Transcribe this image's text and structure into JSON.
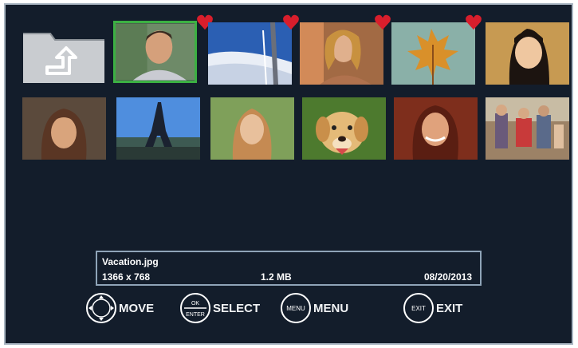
{
  "file_info": {
    "name": "Vacation.jpg",
    "resolution": "1366 x 768",
    "size": "1.2 MB",
    "date": "08/20/2013"
  },
  "controls": {
    "move_label": "MOVE",
    "select_label": "SELECT",
    "select_icon_top": "OK",
    "select_icon_bottom": "ENTER",
    "menu_label": "MENU",
    "menu_icon_text": "MENU",
    "exit_label": "EXIT",
    "exit_icon_text": "EXIT"
  },
  "thumbnails": [
    {
      "name": "up-folder",
      "favorite": false,
      "selected": false
    },
    {
      "name": "man-portrait",
      "favorite": true,
      "selected": true
    },
    {
      "name": "snow-scene",
      "favorite": true,
      "selected": false
    },
    {
      "name": "laughing-woman",
      "favorite": true,
      "selected": false
    },
    {
      "name": "autumn-leaf",
      "favorite": true,
      "selected": false
    },
    {
      "name": "girl-portrait",
      "favorite": false,
      "selected": false
    },
    {
      "name": "woman-smiling",
      "favorite": false,
      "selected": false
    },
    {
      "name": "eiffel-tower",
      "favorite": false,
      "selected": false
    },
    {
      "name": "woman-outdoor",
      "favorite": false,
      "selected": false
    },
    {
      "name": "dog",
      "favorite": false,
      "selected": false
    },
    {
      "name": "woman-red-hair",
      "favorite": false,
      "selected": false
    },
    {
      "name": "family-group",
      "favorite": false,
      "selected": false
    }
  ],
  "colors": {
    "background": "#131d2b",
    "selection": "#3cb043",
    "heart": "#d81e2c",
    "info_border": "#8fa4b8"
  }
}
